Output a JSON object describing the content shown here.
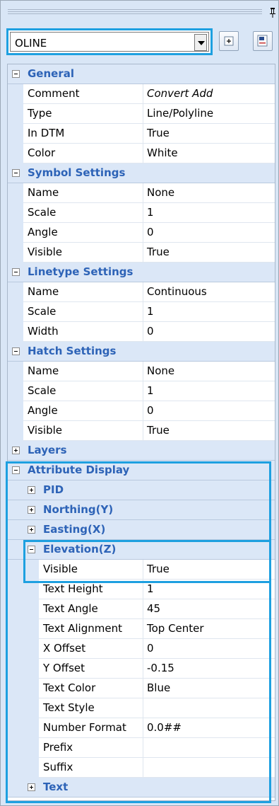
{
  "selector": {
    "value": "OLINE"
  },
  "icons": {
    "pin": "pin-icon",
    "dropdown": "chevron-down-icon",
    "categorized": "categorized-view-icon",
    "pages": "property-pages-icon"
  },
  "colors": {
    "category_text": "#2d63b7",
    "highlight": "#1ea0e0",
    "gutter": "#dbe7f7"
  },
  "general": {
    "title": "General",
    "rows": [
      {
        "name": "Comment",
        "value": "Convert Add"
      },
      {
        "name": "Type",
        "value": "Line/Polyline"
      },
      {
        "name": "In DTM",
        "value": "True"
      },
      {
        "name": "Color",
        "value": "White"
      }
    ]
  },
  "symbol": {
    "title": "Symbol Settings",
    "rows": [
      {
        "name": "Name",
        "value": "None"
      },
      {
        "name": "Scale",
        "value": "1"
      },
      {
        "name": "Angle",
        "value": "0"
      },
      {
        "name": "Visible",
        "value": "True"
      }
    ]
  },
  "linetype": {
    "title": "Linetype Settings",
    "rows": [
      {
        "name": "Name",
        "value": "Continuous"
      },
      {
        "name": "Scale",
        "value": "1"
      },
      {
        "name": "Width",
        "value": "0"
      }
    ]
  },
  "hatch": {
    "title": "Hatch Settings",
    "rows": [
      {
        "name": "Name",
        "value": "None"
      },
      {
        "name": "Scale",
        "value": "1"
      },
      {
        "name": "Angle",
        "value": "0"
      },
      {
        "name": "Visible",
        "value": "True"
      }
    ]
  },
  "layers": {
    "title": "Layers"
  },
  "attribute": {
    "title": "Attribute Display",
    "pid": "PID",
    "northing": "Northing(Y)",
    "easting": "Easting(X)",
    "elevation": {
      "title": "Elevation(Z)",
      "rows": [
        {
          "name": "Visible",
          "value": "True"
        },
        {
          "name": "Text Height",
          "value": "1"
        },
        {
          "name": "Text Angle",
          "value": "45"
        },
        {
          "name": "Text Alignment",
          "value": "Top Center"
        },
        {
          "name": "X Offset",
          "value": "0"
        },
        {
          "name": "Y Offset",
          "value": "-0.15"
        },
        {
          "name": "Text Color",
          "value": "Blue"
        },
        {
          "name": "Text Style",
          "value": ""
        },
        {
          "name": "Number Format",
          "value": "0.0##"
        },
        {
          "name": "Prefix",
          "value": ""
        },
        {
          "name": "Suffix",
          "value": ""
        }
      ]
    },
    "text": "Text"
  }
}
